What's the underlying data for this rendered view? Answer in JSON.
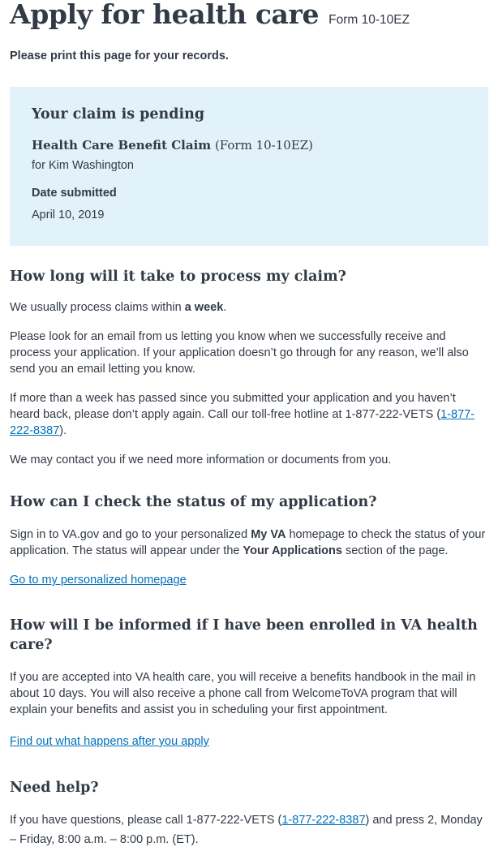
{
  "header": {
    "title": "Apply for health care",
    "form_number": "Form 10-10EZ",
    "print_note": "Please print this page for your records."
  },
  "alert": {
    "heading": "Your claim is pending",
    "claim_title": "Health Care Benefit Claim",
    "claim_form": " (Form 10-10EZ)",
    "for_name": "for Kim Washington",
    "date_label": "Date submitted",
    "date_value": "April 10, 2019",
    "background_color": "#e1f3f8"
  },
  "process": {
    "heading": "How long will it take to process my claim?",
    "p1_before": "We usually process claims within ",
    "p1_bold": "a week",
    "p1_after": ".",
    "p2": "Please look for an email from us letting you know when we successfully receive and process your application. If your application doesn’t go through for any reason, we’ll also send you an email letting you know.",
    "p3_before": "If more than a week has passed since you submitted your application and you haven’t heard back, please don’t apply again. Call our toll-free hotline at 1-877-222-VETS (",
    "p3_link": "1-877-222-8387",
    "p3_after": ").",
    "p4": "We may contact you if we need more information or documents from you."
  },
  "status": {
    "heading": "How can I check the status of my application?",
    "p1_a": "Sign in to VA.gov and go to your personalized ",
    "p1_b": "My VA",
    "p1_c": " homepage to check the status of your application. The status will appear under the ",
    "p1_d": "Your Applications",
    "p1_e": " section of the page.",
    "link": "Go to my personalized homepage"
  },
  "enrolled": {
    "heading": "How will I be informed if I have been enrolled in VA health care?",
    "p1": "If you are accepted into VA health care, you will receive a benefits handbook in the mail in about 10 days. You will also receive a phone call from WelcomeToVA program that will explain your benefits and assist you in scheduling your first appointment.",
    "link": "Find out what happens after you apply"
  },
  "help": {
    "heading": "Need help?",
    "p1_before": "If you have questions, please call 1-877-222-VETS (",
    "p1_link": "1-877-222-8387",
    "p1_after": ") and press 2, Monday – Friday, 8:00 a.m. – 8:00 p.m. (ET)."
  },
  "colors": {
    "text": "#323a45",
    "link": "#0071bb"
  }
}
